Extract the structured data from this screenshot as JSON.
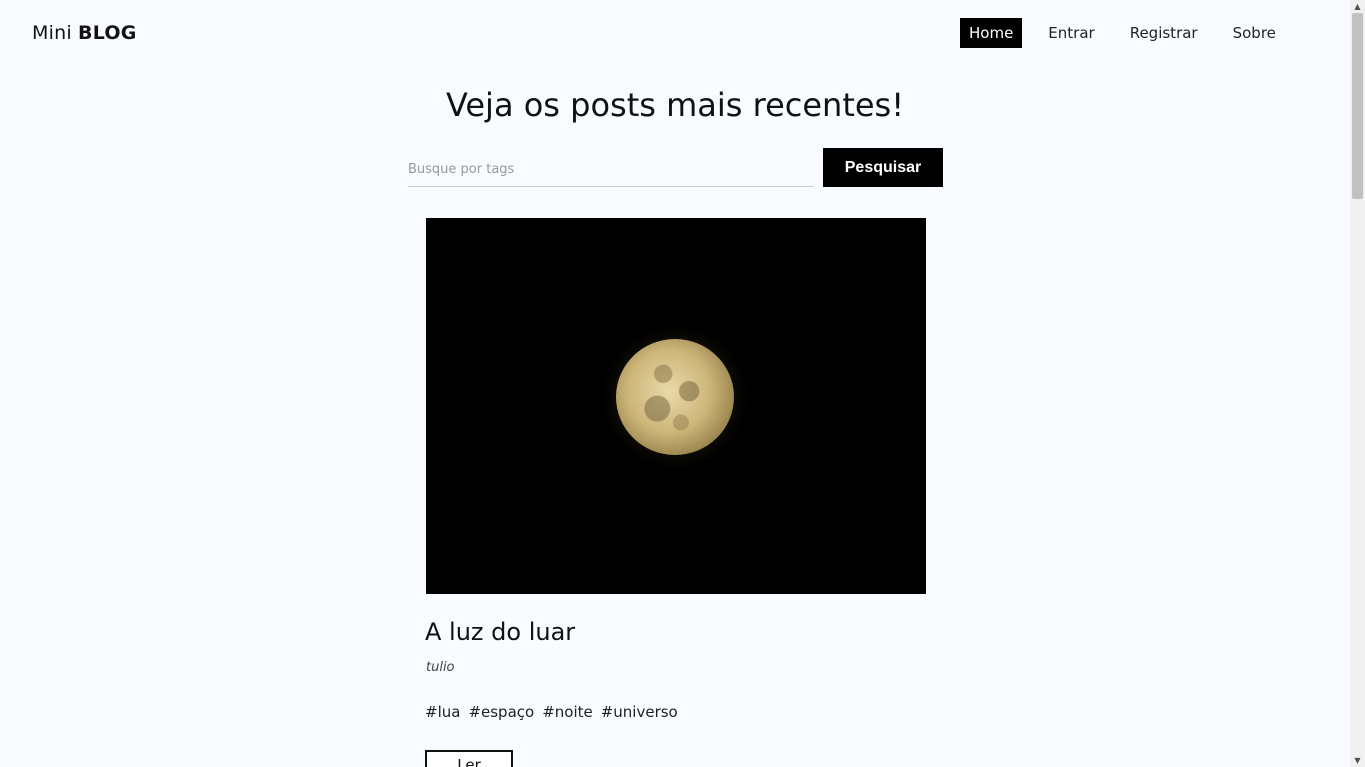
{
  "navbar": {
    "brand_light": "Mini",
    "brand_bold": "BLOG",
    "links": [
      {
        "label": "Home",
        "active": true
      },
      {
        "label": "Entrar",
        "active": false
      },
      {
        "label": "Registrar",
        "active": false
      },
      {
        "label": "Sobre",
        "active": false
      }
    ]
  },
  "main": {
    "headline": "Veja os posts mais recentes!",
    "search": {
      "placeholder": "Busque por tags",
      "value": "",
      "button_label": "Pesquisar"
    }
  },
  "posts": [
    {
      "title": "A luz do luar",
      "author": "tulio",
      "tags": [
        "#lua",
        "#espaço",
        "#noite",
        "#universo"
      ],
      "read_label": "Ler",
      "image": "moon-photo"
    }
  ],
  "colors": {
    "background": "#f8fbff",
    "accent": "#000000",
    "accent_text": "#ffffff"
  },
  "icons": {
    "scroll_up": "▲",
    "scroll_down": "▼"
  }
}
